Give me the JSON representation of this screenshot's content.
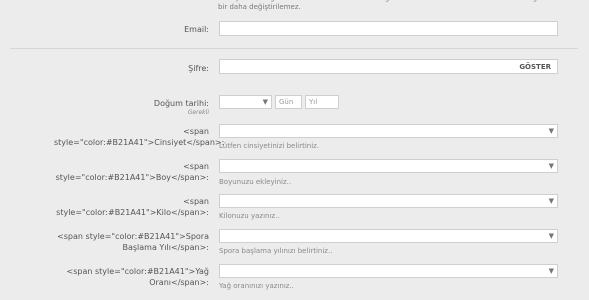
{
  "top_note": "Mesajlarınızda gösterecek kullanıcı adıdır. İstediğiniz ismi kullanabilirsiniz. Bir kez belirlediğinde bir daha değiştirilemez.",
  "email": {
    "label": "Email:",
    "value": ""
  },
  "password": {
    "label": "Şifre:",
    "value": "",
    "show_label": "GÖSTER"
  },
  "birthdate": {
    "label": "Doğum tarihi:",
    "required": "Gerekli",
    "month_value": "",
    "day_placeholder": "Gün",
    "year_placeholder": "Yıl"
  },
  "fields": [
    {
      "label": "<span style=\"color:#B21A41\">Cinsiyet</span>:",
      "hint": "Lütfen cinsiyetinizi belirtiniz."
    },
    {
      "label": "<span style=\"color:#B21A41\">Boy</span>:",
      "hint": "Boyunuzu ekleyiniz.."
    },
    {
      "label": "<span style=\"color:#B21A41\">Kilo</span>:",
      "hint": "Kilonuzu yazınız.."
    },
    {
      "label": "<span style=\"color:#B21A41\">Spora Başlama Yılı</span>:",
      "hint": "Spora başlama yılınızı belirtiniz.."
    },
    {
      "label": "<span style=\"color:#B21A41\">Yağ Oranı</span>:",
      "hint": "Yağ oranınızı yazınız.."
    }
  ],
  "icons": {
    "dropdown": "chevron-down-icon"
  }
}
